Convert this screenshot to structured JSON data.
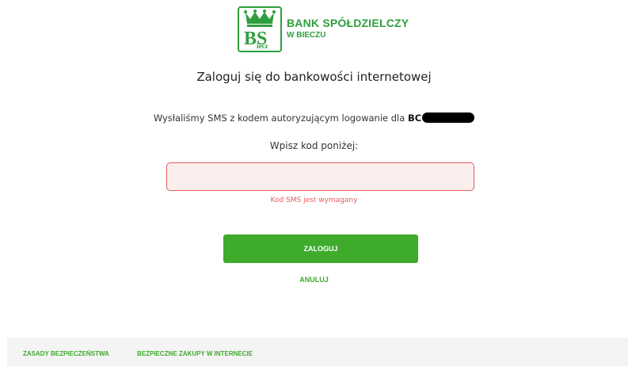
{
  "logo": {
    "monogram": "BS",
    "monogram_sub": "iecz",
    "name_line1": "BANK SPÓŁDZIELCZY",
    "name_line2": "W BIECZU",
    "brand_color": "#2e9e3c"
  },
  "main": {
    "title": "Zaloguj się do bankowości internetowej",
    "sms_info_text": "Wysłaliśmy SMS z kodem autoryzującym logowanie dla ",
    "sms_info_prefix": "BC",
    "enter_code_label": "Wpisz kod poniżej:",
    "code_input": {
      "value": "",
      "placeholder": ""
    },
    "error_text": "Kod SMS jest wymagany",
    "error_color": "#e35d5d",
    "login_label": "ZALOGUJ",
    "cancel_label": "ANULUJ",
    "accent_color": "#3eab2c"
  },
  "footer": {
    "links": [
      "ZASADY BEZPIECZEŃSTWA",
      "BEZPIECZNE ZAKUPY W INTERNECIE"
    ]
  }
}
